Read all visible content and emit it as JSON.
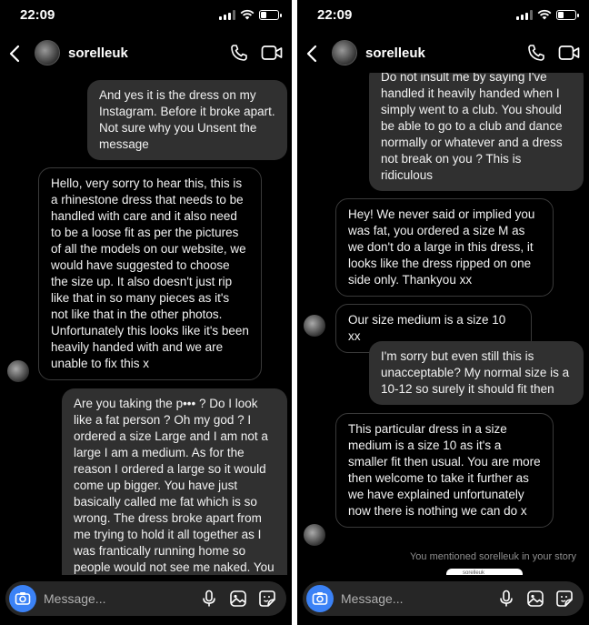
{
  "status": {
    "time": "22:09"
  },
  "header": {
    "username": "sorelleuk"
  },
  "composer": {
    "placeholder": "Message..."
  },
  "left": {
    "messages": [
      {
        "dir": "out",
        "text": "And yes it is the dress on my Instagram. Before it broke apart. Not sure why you Unsent the message"
      },
      {
        "dir": "in",
        "text": "Hello, very sorry to hear this, this is a rhinestone dress that needs to be handled with care and it also need to be a loose fit as per the pictures of all the models on our website, we would have suggested to choose the size up. It also doesn't just rip like that in so many pieces as it's not like that in the other photos. Unfortunately this looks like it's been heavily handed with and we are unable to fix this x"
      },
      {
        "dir": "out",
        "text": "Are you taking the p••• ? Do I look like a fat person ? Oh my god ? I ordered a size Large and I am not a large I am a medium. As for the reason I ordered a large so it would come up bigger. You have just basically called me fat which is so wrong. The dress broke apart from me trying to hold it all together as I was frantically running home so people would not see me naked. You as the supplier have a duty to"
      }
    ]
  },
  "right": {
    "messages": [
      {
        "dir": "out",
        "text": "Do not insult me by saying I've handled it heavily handed when I simply went to a club. You should be able to go to a club and dance normally or whatever and a dress not break on you ? This is ridiculous"
      },
      {
        "dir": "in",
        "text": "Hey! We never said or implied you was fat, you ordered a size M as we don't do a large in this dress, it looks like the dress ripped on one side only. Thankyou xx"
      },
      {
        "dir": "in",
        "text": "Our size medium is a size 10 xx"
      },
      {
        "dir": "out",
        "text": "I'm sorry but even still this is unacceptable? My normal size is a 10-12 so surely it should fit then"
      },
      {
        "dir": "in",
        "text": "This particular dress in a size medium is a size 10 as it's a smaller fit then usual. You are more then welcome to take it further as we have explained unfortunately now there is nothing we can do x"
      }
    ],
    "mention": "You mentioned sorelleuk in your story",
    "story_caption": "sorelleuk"
  },
  "icons": [
    "back-icon",
    "phone-icon",
    "video-icon",
    "camera-icon",
    "microphone-icon",
    "gallery-icon",
    "sticker-icon"
  ]
}
